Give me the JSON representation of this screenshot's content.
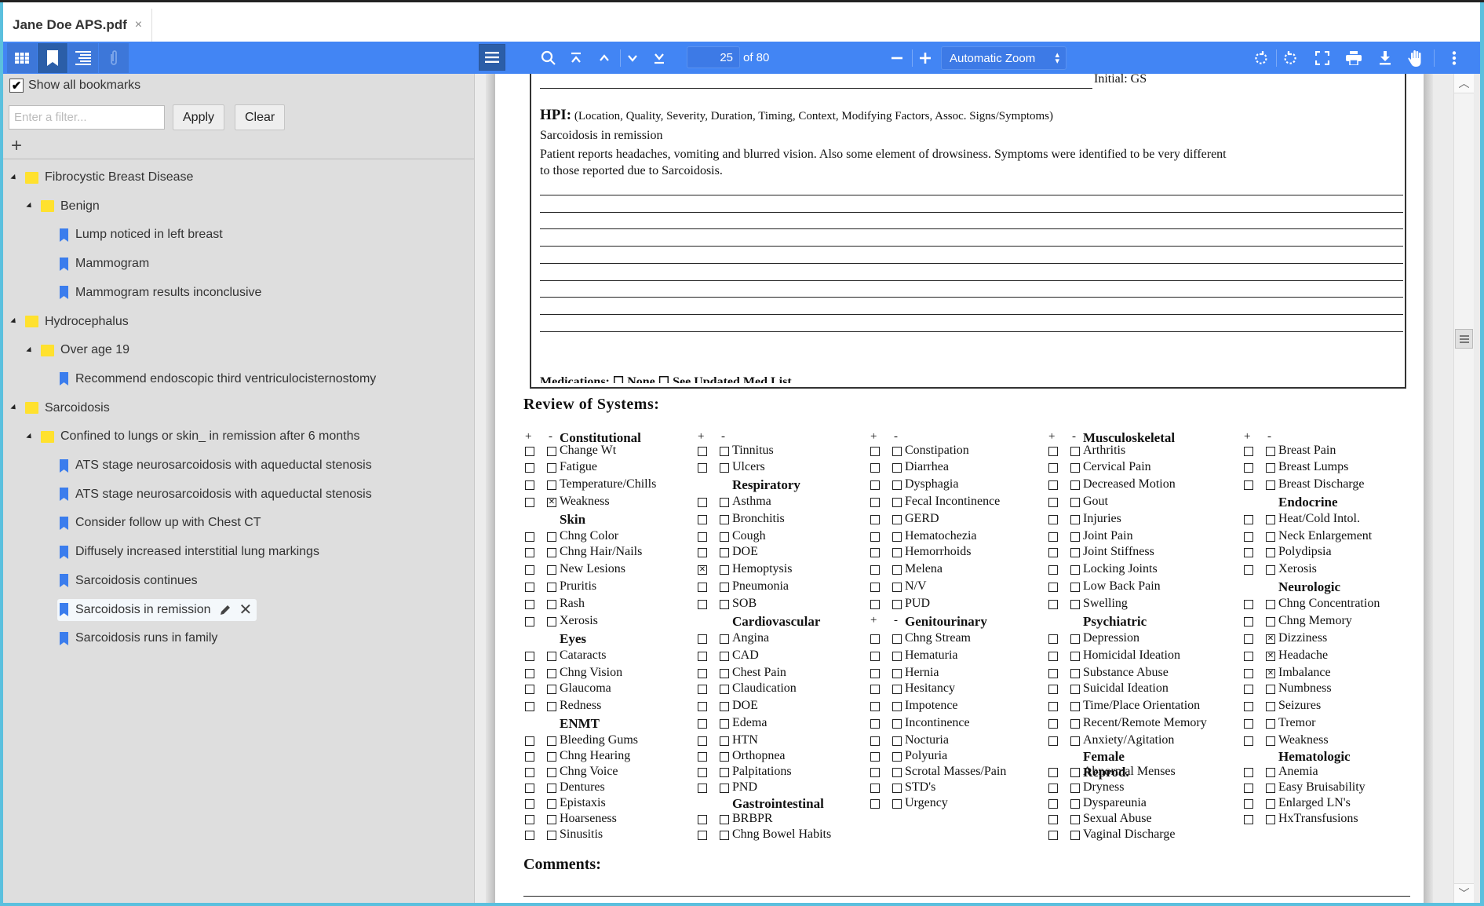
{
  "tab": {
    "title": "Jane Doe APS.pdf",
    "close": "×"
  },
  "sidebar_toolbar": {
    "buttons": [
      {
        "name": "thumbnails",
        "icon": "grid-icon"
      },
      {
        "name": "bookmarks",
        "icon": "bookmark-icon",
        "active": true
      },
      {
        "name": "outline",
        "icon": "outline-icon"
      },
      {
        "name": "attachments",
        "icon": "paperclip-icon"
      }
    ]
  },
  "toolbar": {
    "page_current": "25",
    "page_of": "of 80",
    "zoom_value": "Automatic Zoom",
    "icons": [
      "menu-icon",
      "search-icon",
      "first-page-icon",
      "prev-page-icon",
      "next-page-icon",
      "last-page-icon",
      "zoom-out-icon",
      "zoom-in-icon",
      "rotate-ccw-icon",
      "rotate-cw-icon",
      "fullscreen-icon",
      "print-icon",
      "download-icon",
      "hand-tool-icon",
      "more-icon"
    ]
  },
  "sidebar": {
    "show_all_label": "Show all bookmarks",
    "show_all_checked": true,
    "filter_placeholder": "Enter a filter...",
    "filter_value": "",
    "apply_label": "Apply",
    "clear_label": "Clear",
    "add_label": "+",
    "tree": [
      {
        "type": "folder",
        "level": 0,
        "label": "Fibrocystic Breast Disease"
      },
      {
        "type": "folder",
        "level": 1,
        "label": "Benign"
      },
      {
        "type": "bookmark",
        "level": 2,
        "label": "Lump noticed in left breast"
      },
      {
        "type": "bookmark",
        "level": 2,
        "label": "Mammogram"
      },
      {
        "type": "bookmark",
        "level": 2,
        "label": "Mammogram results inconclusive"
      },
      {
        "type": "folder",
        "level": 0,
        "label": "Hydrocephalus"
      },
      {
        "type": "folder",
        "level": 1,
        "label": "Over age 19"
      },
      {
        "type": "bookmark",
        "level": 2,
        "label": "Recommend endoscopic third ventriculocisternostomy"
      },
      {
        "type": "folder",
        "level": 0,
        "label": "Sarcoidosis"
      },
      {
        "type": "folder",
        "level": 1,
        "label": "Confined to lungs or skin_ in remission after 6 months"
      },
      {
        "type": "bookmark",
        "level": 2,
        "label": "ATS stage neurosarcoidosis with aqueductal stenosis"
      },
      {
        "type": "bookmark",
        "level": 2,
        "label": "ATS stage neurosarcoidosis with aqueductal stenosis"
      },
      {
        "type": "bookmark",
        "level": 2,
        "label": "Consider follow up with Chest CT"
      },
      {
        "type": "bookmark",
        "level": 2,
        "label": "Diffusely increased interstitial lung markings"
      },
      {
        "type": "bookmark",
        "level": 2,
        "label": "Sarcoidosis continues"
      },
      {
        "type": "bookmark",
        "level": 2,
        "label": "Sarcoidosis in remission",
        "selected": true
      },
      {
        "type": "bookmark",
        "level": 2,
        "label": "Sarcoidosis runs in family"
      }
    ]
  },
  "document": {
    "initial": "Initial: GS",
    "hpi_label": "HPI:",
    "hpi_hint": "(Location, Quality, Severity, Duration, Timing, Context, Modifying Factors, Assoc. Signs/Symptoms)",
    "hpi_line1": "Sarcoidosis in remission",
    "hpi_line2": "Patient reports headaches, vomiting and blurred vision. Also some element of drowsiness. Symptoms were identified to be very different",
    "hpi_line3": "to those reported due to Sarcoidosis.",
    "medications_partial": "Medications:   ☐ None          ☐ See Updated Med List",
    "ros_title": "Review of Systems:",
    "comments_label": "Comments:",
    "ros_columns": [
      [
        {
          "pm": true,
          "head": "Constitutional"
        },
        {
          "label": "Change Wt"
        },
        {
          "label": "Fatigue"
        },
        {
          "label": "Temperature/Chills"
        },
        {
          "label": "Weakness",
          "minus": true
        },
        {
          "head": "Skin"
        },
        {
          "label": "Chng Color"
        },
        {
          "label": "Chng Hair/Nails"
        },
        {
          "label": "New Lesions"
        },
        {
          "label": "Pruritis"
        },
        {
          "label": "Rash"
        },
        {
          "label": "Xerosis"
        },
        {
          "head": "Eyes"
        },
        {
          "label": "Cataracts"
        },
        {
          "label": "Chng Vision"
        },
        {
          "label": "Glaucoma"
        },
        {
          "label": "Redness"
        },
        {
          "head": "ENMT"
        },
        {
          "label": "Bleeding Gums"
        },
        {
          "label": "Chng Hearing"
        },
        {
          "label": "Chng Voice"
        },
        {
          "label": "Dentures"
        },
        {
          "label": "Epistaxis"
        },
        {
          "label": "Hoarseness"
        },
        {
          "label": "Sinusitis"
        }
      ],
      [
        {
          "pm": true,
          "head": ""
        },
        {
          "label": "Tinnitus"
        },
        {
          "label": "Ulcers"
        },
        {
          "head": "Respiratory"
        },
        {
          "label": "Asthma"
        },
        {
          "label": "Bronchitis"
        },
        {
          "label": "Cough"
        },
        {
          "label": "DOE"
        },
        {
          "label": "Hemoptysis",
          "plus": true
        },
        {
          "label": "Pneumonia"
        },
        {
          "label": "SOB"
        },
        {
          "head": "Cardiovascular"
        },
        {
          "label": "Angina"
        },
        {
          "label": "CAD"
        },
        {
          "label": "Chest Pain"
        },
        {
          "label": "Claudication"
        },
        {
          "label": "DOE"
        },
        {
          "label": "Edema"
        },
        {
          "label": "HTN"
        },
        {
          "label": "Orthopnea"
        },
        {
          "label": "Palpitations"
        },
        {
          "label": "PND"
        },
        {
          "head": "Gastrointestinal"
        },
        {
          "label": "BRBPR"
        },
        {
          "label": "Chng Bowel Habits"
        }
      ],
      [
        {
          "pm": true,
          "head": ""
        },
        {
          "label": "Constipation"
        },
        {
          "label": "Diarrhea"
        },
        {
          "label": "Dysphagia"
        },
        {
          "label": "Fecal Incontinence"
        },
        {
          "label": "GERD"
        },
        {
          "label": "Hematochezia"
        },
        {
          "label": "Hemorrhoids"
        },
        {
          "label": "Melena"
        },
        {
          "label": "N/V"
        },
        {
          "label": "PUD"
        },
        {
          "pm": true,
          "head": "Genitourinary"
        },
        {
          "label": "Chng Stream"
        },
        {
          "label": "Hematuria"
        },
        {
          "label": "Hernia"
        },
        {
          "label": "Hesitancy"
        },
        {
          "label": "Impotence"
        },
        {
          "label": "Incontinence"
        },
        {
          "label": "Nocturia"
        },
        {
          "label": "Polyuria"
        },
        {
          "label": "Scrotal Masses/Pain"
        },
        {
          "label": "STD's"
        },
        {
          "label": "Urgency"
        }
      ],
      [
        {
          "pm": true,
          "head": "Musculoskeletal"
        },
        {
          "label": "Arthritis"
        },
        {
          "label": "Cervical Pain"
        },
        {
          "label": "Decreased Motion"
        },
        {
          "label": "Gout"
        },
        {
          "label": "Injuries"
        },
        {
          "label": "Joint Pain"
        },
        {
          "label": "Joint Stiffness"
        },
        {
          "label": "Locking Joints"
        },
        {
          "label": "Low Back Pain"
        },
        {
          "label": "Swelling"
        },
        {
          "head": "Psychiatric"
        },
        {
          "label": "Depression"
        },
        {
          "label": "Homicidal Ideation"
        },
        {
          "label": "Substance Abuse"
        },
        {
          "label": "Suicidal Ideation"
        },
        {
          "label": "Time/Place Orientation"
        },
        {
          "label": "Recent/Remote Memory"
        },
        {
          "label": "Anxiety/Agitation"
        },
        {
          "head": "Female Reprod."
        },
        {
          "label": "Abnormal Menses"
        },
        {
          "label": "Dryness"
        },
        {
          "label": "Dyspareunia"
        },
        {
          "label": "Sexual Abuse"
        },
        {
          "label": "Vaginal Discharge"
        }
      ],
      [
        {
          "pm": true,
          "head": ""
        },
        {
          "label": "Breast Pain"
        },
        {
          "label": "Breast Lumps"
        },
        {
          "label": "Breast Discharge"
        },
        {
          "head": "Endocrine"
        },
        {
          "label": "Heat/Cold Intol."
        },
        {
          "label": "Neck Enlargement"
        },
        {
          "label": "Polydipsia"
        },
        {
          "label": "Xerosis"
        },
        {
          "head": "Neurologic"
        },
        {
          "label": "Chng Concentration"
        },
        {
          "label": "Chng Memory"
        },
        {
          "label": "Dizziness",
          "minus": true
        },
        {
          "label": "Headache",
          "minus": true
        },
        {
          "label": "Imbalance",
          "minus": true
        },
        {
          "label": "Numbness"
        },
        {
          "label": "Seizures"
        },
        {
          "label": "Tremor"
        },
        {
          "label": "Weakness"
        },
        {
          "head": "Hematologic"
        },
        {
          "label": "Anemia"
        },
        {
          "label": "Easy Bruisability"
        },
        {
          "label": "Enlarged LN's"
        },
        {
          "label": "HxTransfusions"
        }
      ]
    ]
  },
  "colors": {
    "toolbar": "#4285f4",
    "folder": "#ffe12e",
    "bookmark": "#3b7ded",
    "accent_border": "#5bc0de"
  }
}
